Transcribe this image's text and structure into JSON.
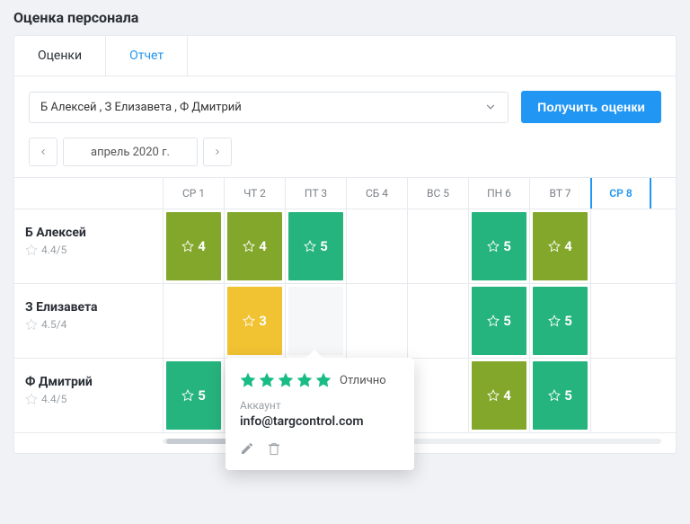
{
  "pageTitle": "Оценка персонала",
  "tabs": {
    "active": "Оценки",
    "inactive": "Отчет"
  },
  "filter": {
    "selectValue": "Б Алексей , З Елизавета , Ф Дмитрий",
    "buttonLabel": "Получить оценки"
  },
  "monthNav": {
    "label": "апрель 2020 г."
  },
  "dayHeaders": [
    "СР 1",
    "ЧТ 2",
    "ПТ 3",
    "СБ 4",
    "ВС 5",
    "ПН 6",
    "ВТ 7",
    "СР 8"
  ],
  "employees": [
    {
      "name": "Б Алексей",
      "rating": "4.4/5",
      "cells": [
        {
          "score": "4",
          "cls": "c-green2"
        },
        {
          "score": "4",
          "cls": "c-green2"
        },
        {
          "score": "5",
          "cls": "c-green1"
        },
        null,
        null,
        {
          "score": "5",
          "cls": "c-green1"
        },
        {
          "score": "4",
          "cls": "c-green2"
        },
        null
      ]
    },
    {
      "name": "З Елизавета",
      "rating": "4.5/4",
      "cells": [
        null,
        {
          "score": "3",
          "cls": "c-yellow"
        },
        {
          "score": "",
          "cls": "c-faded"
        },
        null,
        null,
        {
          "score": "5",
          "cls": "c-green1"
        },
        {
          "score": "5",
          "cls": "c-green1"
        },
        null
      ]
    },
    {
      "name": "Ф Дмитрий",
      "rating": "4.4/5",
      "cells": [
        {
          "score": "5",
          "cls": "c-green1"
        },
        {
          "score": "",
          "cls": "c-green1",
          "popoverAnchor": true
        },
        {
          "score": "",
          "cls": "c-green1",
          "hidden": true
        },
        null,
        null,
        {
          "score": "4",
          "cls": "c-green2"
        },
        {
          "score": "5",
          "cls": "c-green1"
        },
        null
      ]
    }
  ],
  "popover": {
    "ratingLabel": "Отлично",
    "accountLabel": "Аккаунт",
    "accountValue": "info@targcontrol.com"
  }
}
